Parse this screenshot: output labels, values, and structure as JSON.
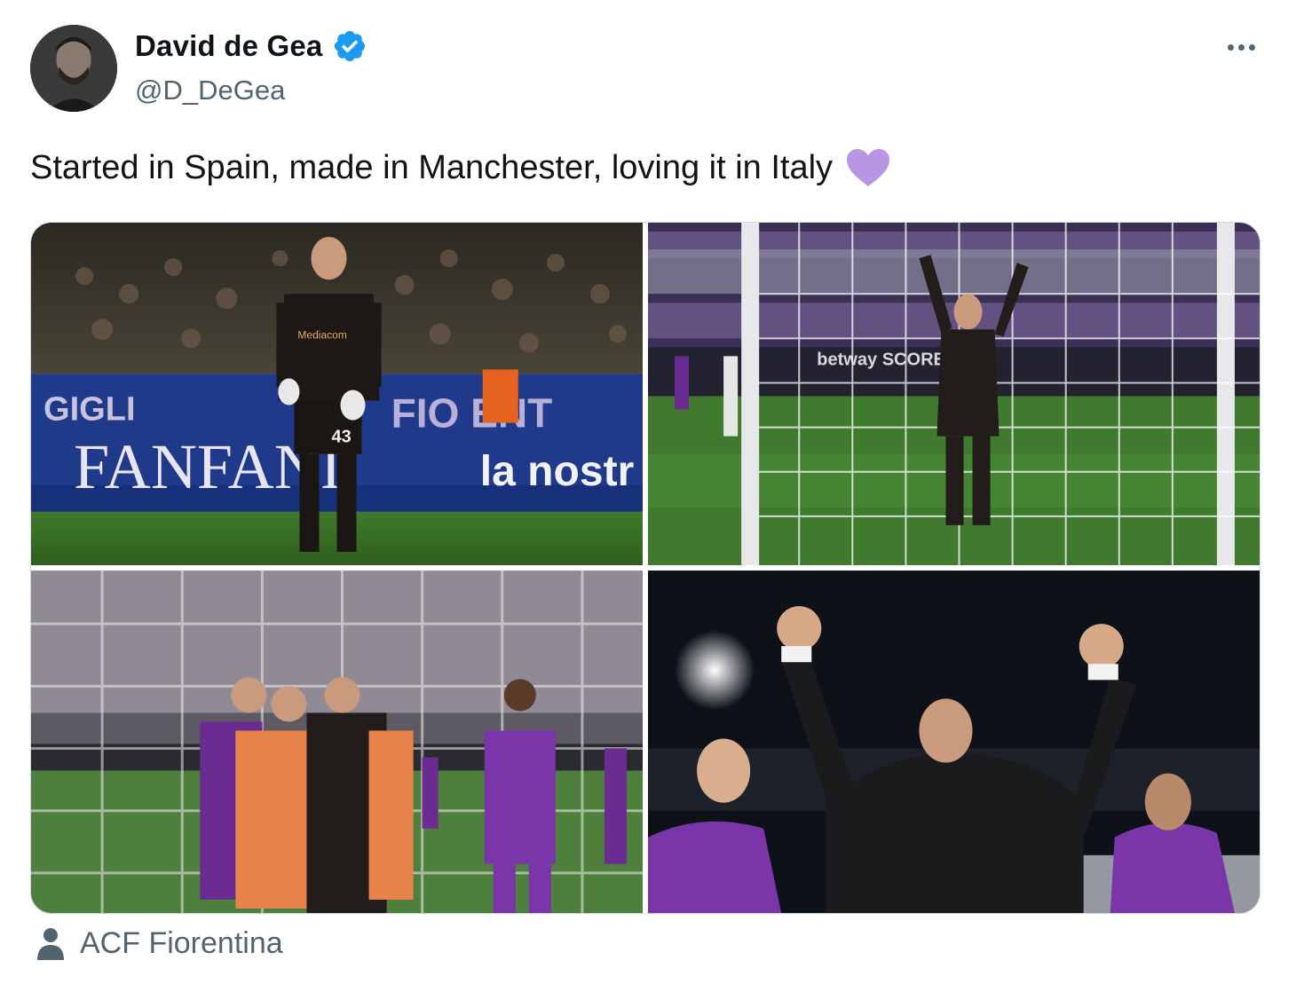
{
  "author": {
    "display_name": "David de Gea",
    "handle": "@D_DeGea",
    "verified": true,
    "verified_icon": "verified-badge-icon",
    "avatar_icon": "profile-avatar"
  },
  "menu": {
    "icon": "more-options-icon"
  },
  "tweet": {
    "text": "Started in Spain, made in Manchester, loving it in Italy",
    "emoji": "purple-heart-icon"
  },
  "media": {
    "photos": [
      {
        "id": "photo-1"
      },
      {
        "id": "photo-2"
      },
      {
        "id": "photo-3"
      },
      {
        "id": "photo-4"
      }
    ],
    "photo_1_signs": {
      "line1": "GIGLI",
      "line2": "FANFANI",
      "line3": "FIO ENT",
      "line4": "la nostr",
      "kit": "Mediacom",
      "number": "43"
    },
    "photo_2_signs": {
      "board": "betway SCORES"
    }
  },
  "tagged": {
    "icon": "person-icon",
    "label": "ACF Fiorentina"
  },
  "colors": {
    "text": "#0f1419",
    "secondary": "#536471",
    "verified": "#1d9bf0",
    "purple": "#6a2c91",
    "heart": "#b896e4"
  }
}
